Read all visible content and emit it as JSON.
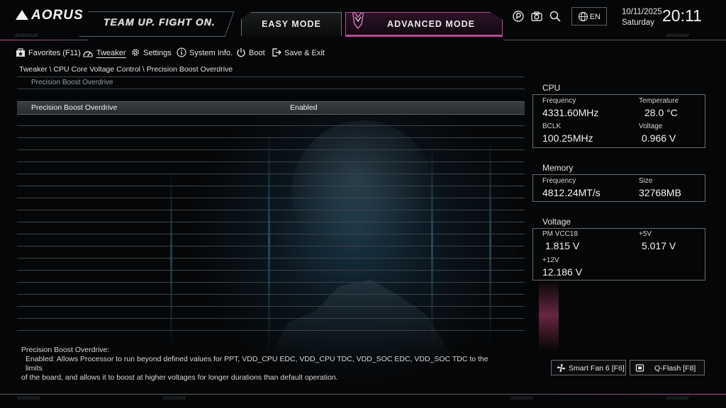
{
  "header": {
    "brand": "AORUS",
    "slogan": "TEAM UP. FIGHT ON.",
    "easy_mode": "EASY MODE",
    "advanced_mode": "ADVANCED MODE",
    "language": "EN",
    "date": "10/11/2025",
    "weekday": "Saturday",
    "time": "20:11"
  },
  "nav": [
    {
      "label": "Favorites (F11)",
      "icon": "favorites-icon"
    },
    {
      "label": "Tweaker",
      "icon": "gauge-icon"
    },
    {
      "label": "Settings",
      "icon": "gear-icon"
    },
    {
      "label": "System Info.",
      "icon": "info-icon"
    },
    {
      "label": "Boot",
      "icon": "power-icon"
    },
    {
      "label": "Save & Exit",
      "icon": "exit-icon"
    }
  ],
  "breadcrumb": "Tweaker \\ CPU Core Voltage Control \\ Precision Boost Overdrive",
  "list": {
    "section_title": "Precision Boost Overdrive",
    "rows": [
      {
        "label": "Precision Boost Overdrive",
        "value": "Enabled"
      }
    ]
  },
  "help": {
    "title": "Precision Boost Overdrive:",
    "line1": "Enabled: Allows Processor to run beyond defined values for PPT, VDD_CPU EDC, VDD_CPU TDC, VDD_SOC EDC, VDD_SOC TDC to the limits",
    "line2": "of the board, and allows it to boost at higher voltages for longer durations than default operation."
  },
  "cpu": {
    "title": "CPU",
    "frequency_label": "Frequency",
    "frequency": "4331.60MHz",
    "temperature_label": "Temperature",
    "temperature": "28.0 °C",
    "bclk_label": "BCLK",
    "bclk": "100.25MHz",
    "voltage_label": "Voltage",
    "voltage": "0.966 V"
  },
  "memory": {
    "title": "Memory",
    "frequency_label": "Frequency",
    "frequency": "4812.24MT/s",
    "size_label": "Size",
    "size": "32768MB"
  },
  "voltage": {
    "title": "Voltage",
    "pm_vcc18_label": "PM VCC18",
    "pm_vcc18": "1.815 V",
    "v5_label": "+5V",
    "v5": "5.017 V",
    "v12_label": "+12V",
    "v12": "12.186 V"
  },
  "buttons": {
    "smart_fan": "Smart Fan 6 [F6]",
    "qflash": "Q-Flash [F8]"
  },
  "colors": {
    "accent": "#c04a9a",
    "border": "#6a6e72",
    "background": "#050607"
  }
}
